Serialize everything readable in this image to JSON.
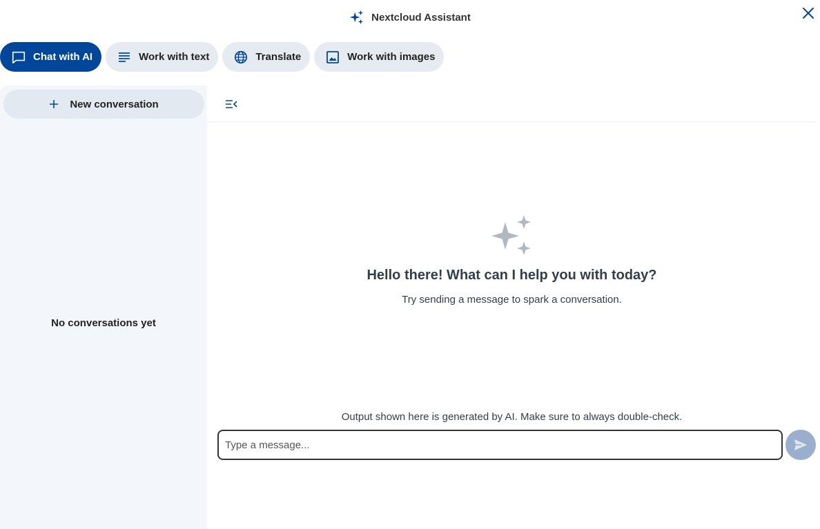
{
  "header": {
    "title": "Nextcloud Assistant",
    "title_icon": "sparkles-icon",
    "close_icon": "close-icon"
  },
  "tabs": [
    {
      "label": "Chat with AI",
      "icon": "chat-icon",
      "active": true
    },
    {
      "label": "Work with text",
      "icon": "text-lines-icon",
      "active": false
    },
    {
      "label": "Translate",
      "icon": "globe-icon",
      "active": false
    },
    {
      "label": "Work with images",
      "icon": "image-icon",
      "active": false
    }
  ],
  "sidebar": {
    "new_conversation_label": "New conversation",
    "empty_label": "No conversations yet"
  },
  "main": {
    "empty_title": "Hello there! What can I help you with today?",
    "empty_subtitle": "Try sending a message to spark a conversation.",
    "disclaimer": "Output shown here is generated by AI. Make sure to always double-check.",
    "input_placeholder": "Type a message..."
  },
  "colors": {
    "accent": "#00479c",
    "tab_bg": "#e6ebf2",
    "sidebar_bg": "#f3f6fa",
    "send_button": "#9aaecd",
    "sparkle_gray": "#b0b8c2"
  }
}
